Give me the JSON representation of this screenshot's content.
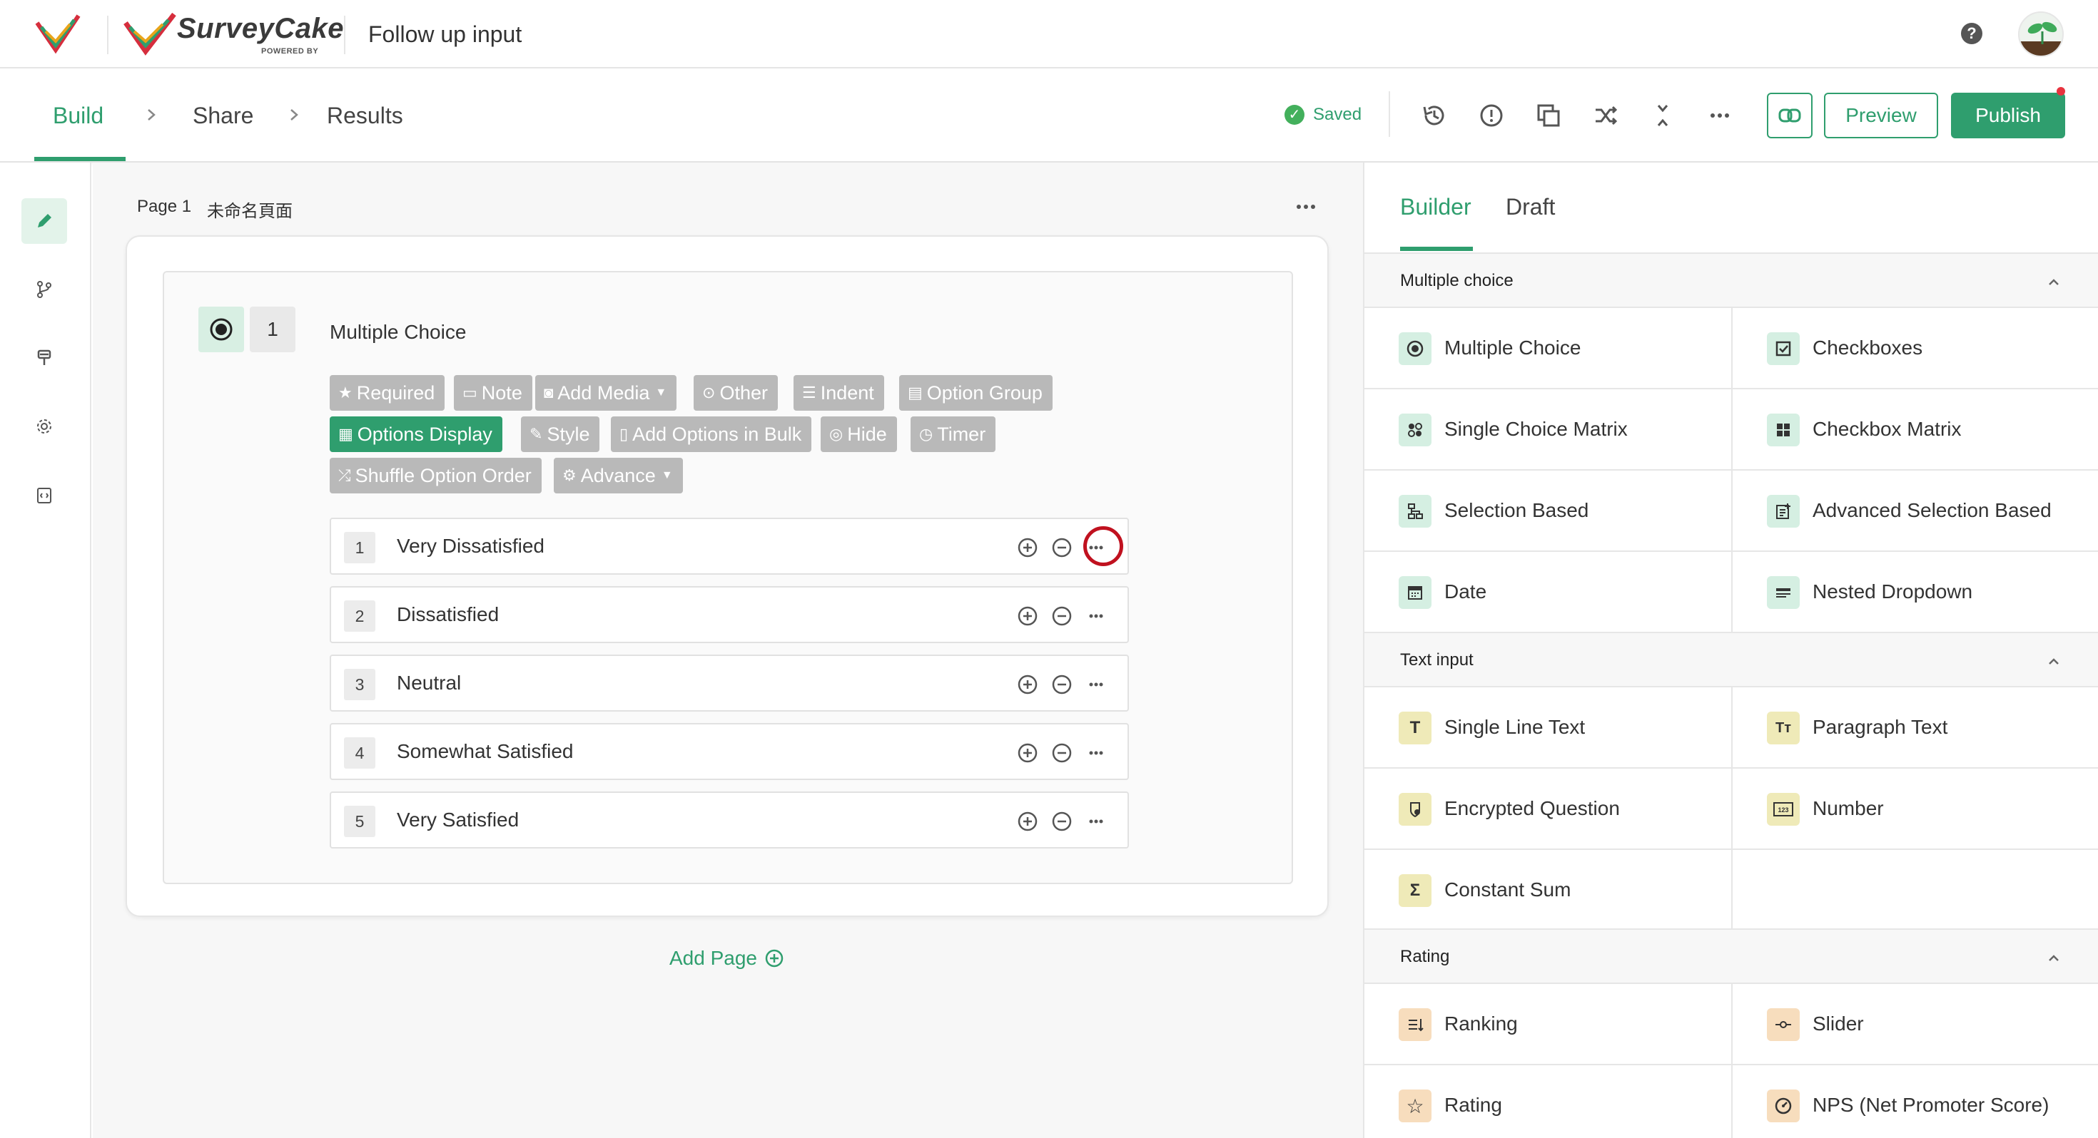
{
  "header": {
    "brand": "SurveyCake",
    "powered_by": "POWERED BY",
    "survey_title": "Follow up input",
    "help_label": "?"
  },
  "nav": {
    "steps": [
      "Build",
      "Share",
      "Results"
    ],
    "active_step": "Build",
    "saved_label": "Saved",
    "preview_label": "Preview",
    "publish_label": "Publish"
  },
  "page": {
    "label": "Page 1",
    "name": "未命名頁面",
    "add_page_label": "Add Page"
  },
  "question": {
    "number": "1",
    "title": "Multiple Choice",
    "settings": [
      {
        "label": "Required",
        "icon": "star-icon",
        "active": false
      },
      {
        "label": "Note",
        "icon": "note-icon",
        "active": false
      },
      {
        "label": "Add Media",
        "icon": "camera-icon",
        "active": false,
        "dropdown": true
      },
      {
        "label": "Other",
        "icon": "radio-icon",
        "active": false
      },
      {
        "label": "Indent",
        "icon": "indent-icon",
        "active": false
      },
      {
        "label": "Option Group",
        "icon": "list-icon",
        "active": false
      },
      {
        "label": "Options Display",
        "icon": "grid-icon",
        "active": true
      },
      {
        "label": "Style",
        "icon": "brush-icon",
        "active": false
      },
      {
        "label": "Add Options in Bulk",
        "icon": "document-icon",
        "active": false
      },
      {
        "label": "Hide",
        "icon": "eye-off-icon",
        "active": false
      },
      {
        "label": "Timer",
        "icon": "clock-icon",
        "active": false
      },
      {
        "label": "Shuffle Option Order",
        "icon": "shuffle-icon",
        "active": false
      },
      {
        "label": "Advance",
        "icon": "gear-icon",
        "active": false,
        "dropdown": true
      }
    ],
    "options": [
      {
        "num": "1",
        "label": "Very Dissatisfied"
      },
      {
        "num": "2",
        "label": "Dissatisfied"
      },
      {
        "num": "3",
        "label": "Neutral"
      },
      {
        "num": "4",
        "label": "Somewhat Satisfied"
      },
      {
        "num": "5",
        "label": "Very Satisfied"
      }
    ]
  },
  "builder": {
    "tabs": [
      "Builder",
      "Draft"
    ],
    "active_tab": "Builder",
    "sections": [
      {
        "title": "Multiple choice",
        "items": [
          {
            "label": "Multiple Choice",
            "icon": "radio-icon",
            "color": "green"
          },
          {
            "label": "Checkboxes",
            "icon": "checkbox-icon",
            "color": "green"
          },
          {
            "label": "Single Choice Matrix",
            "icon": "matrix-dots-icon",
            "color": "green"
          },
          {
            "label": "Checkbox Matrix",
            "icon": "matrix-squares-icon",
            "color": "green"
          },
          {
            "label": "Selection Based",
            "icon": "hierarchy-icon",
            "color": "green"
          },
          {
            "label": "Advanced Selection Based",
            "icon": "add-list-icon",
            "color": "green"
          },
          {
            "label": "Date",
            "icon": "calendar-icon",
            "color": "green"
          },
          {
            "label": "Nested Dropdown",
            "icon": "dropdown-icon",
            "color": "green"
          }
        ]
      },
      {
        "title": "Text input",
        "items": [
          {
            "label": "Single Line Text",
            "icon": "text-icon",
            "glyph": "T",
            "color": "yellow"
          },
          {
            "label": "Paragraph Text",
            "icon": "paragraph-icon",
            "glyph": "Tт",
            "color": "yellow"
          },
          {
            "label": "Encrypted Question",
            "icon": "lock-icon",
            "color": "yellow"
          },
          {
            "label": "Number",
            "icon": "number-icon",
            "glyph": "123",
            "color": "yellow"
          },
          {
            "label": "Constant Sum",
            "icon": "sigma-icon",
            "glyph": "Σ",
            "color": "yellow"
          }
        ]
      },
      {
        "title": "Rating",
        "items": [
          {
            "label": "Ranking",
            "icon": "ranking-icon",
            "color": "orange"
          },
          {
            "label": "Slider",
            "icon": "slider-icon",
            "color": "orange"
          },
          {
            "label": "Rating",
            "icon": "star-icon",
            "glyph": "☆",
            "color": "orange"
          },
          {
            "label": "NPS (Net Promoter Score)",
            "icon": "gauge-icon",
            "color": "orange"
          }
        ]
      }
    ]
  },
  "colors": {
    "accent": "#2f9e6e",
    "chip_inactive": "#b9b9b9",
    "highlight": "#c0111f",
    "icon_green": "#d5efe2",
    "icon_yellow": "#efeab8",
    "icon_orange": "#f7ddbd"
  }
}
